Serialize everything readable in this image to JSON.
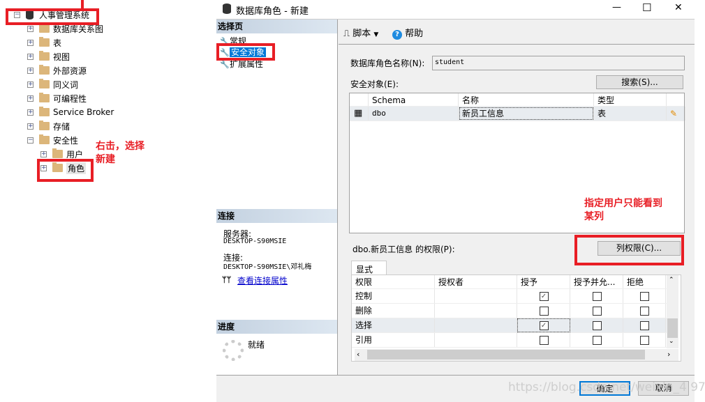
{
  "tree": {
    "root": "人事管理系统",
    "items": [
      "数据库关系图",
      "表",
      "视图",
      "外部资源",
      "同义词",
      "可编程性",
      "Service Broker",
      "存储",
      "安全性"
    ],
    "security_children": [
      "用户",
      "角色"
    ]
  },
  "annotations": {
    "right_click": "右击，选择\n新建",
    "column_hint": "指定用户只能看到\n某列"
  },
  "dialog": {
    "title": "数据库角色 - 新建",
    "window_controls": {
      "minimize": "—",
      "maximize": "☐",
      "close": "✕"
    },
    "select_page": {
      "header": "选择页",
      "items": [
        "常规",
        "安全对象",
        "扩展属性"
      ],
      "selected": "安全对象"
    },
    "connection": {
      "header": "连接",
      "server_label": "服务器:",
      "server": "DESKTOP-S90MSIE",
      "conn_label": "连接:",
      "conn": "DESKTOP-S90MSIE\\邓礼梅",
      "link": "查看连接属性"
    },
    "progress": {
      "header": "进度",
      "status": "就绪"
    },
    "toolbar": {
      "script": "脚本",
      "help": "帮助"
    },
    "role_name_label": "数据库角色名称(N):",
    "role_name_value": "student",
    "securables_label": "安全对象(E):",
    "search_button": "搜索(S)...",
    "securables": {
      "columns": [
        "Schema",
        "名称",
        "类型"
      ],
      "rows": [
        {
          "schema": "dbo",
          "name": "新员工信息",
          "type": "表"
        }
      ]
    },
    "permissions_label": "dbo.新员工信息 的权限(P):",
    "column_perms_button": "列权限(C)...",
    "tab": "显式",
    "permissions": {
      "columns": [
        "权限",
        "授权者",
        "授予",
        "授予并允...",
        "拒绝"
      ],
      "rows": [
        {
          "perm": "控制",
          "grantor": "",
          "grant": true,
          "with_grant": false,
          "deny": false
        },
        {
          "perm": "删除",
          "grantor": "",
          "grant": false,
          "with_grant": false,
          "deny": false
        },
        {
          "perm": "选择",
          "grantor": "",
          "grant": true,
          "with_grant": false,
          "deny": false
        },
        {
          "perm": "引用",
          "grantor": "",
          "grant": false,
          "with_grant": false,
          "deny": false
        }
      ]
    },
    "ok": "确定",
    "cancel": "取消"
  },
  "watermark": "https://blog.csdn.net/weixin_4  9713",
  "colors": {
    "annotation": "#e81e25",
    "selection": "#0078d7",
    "folder": "#dcb67a"
  }
}
